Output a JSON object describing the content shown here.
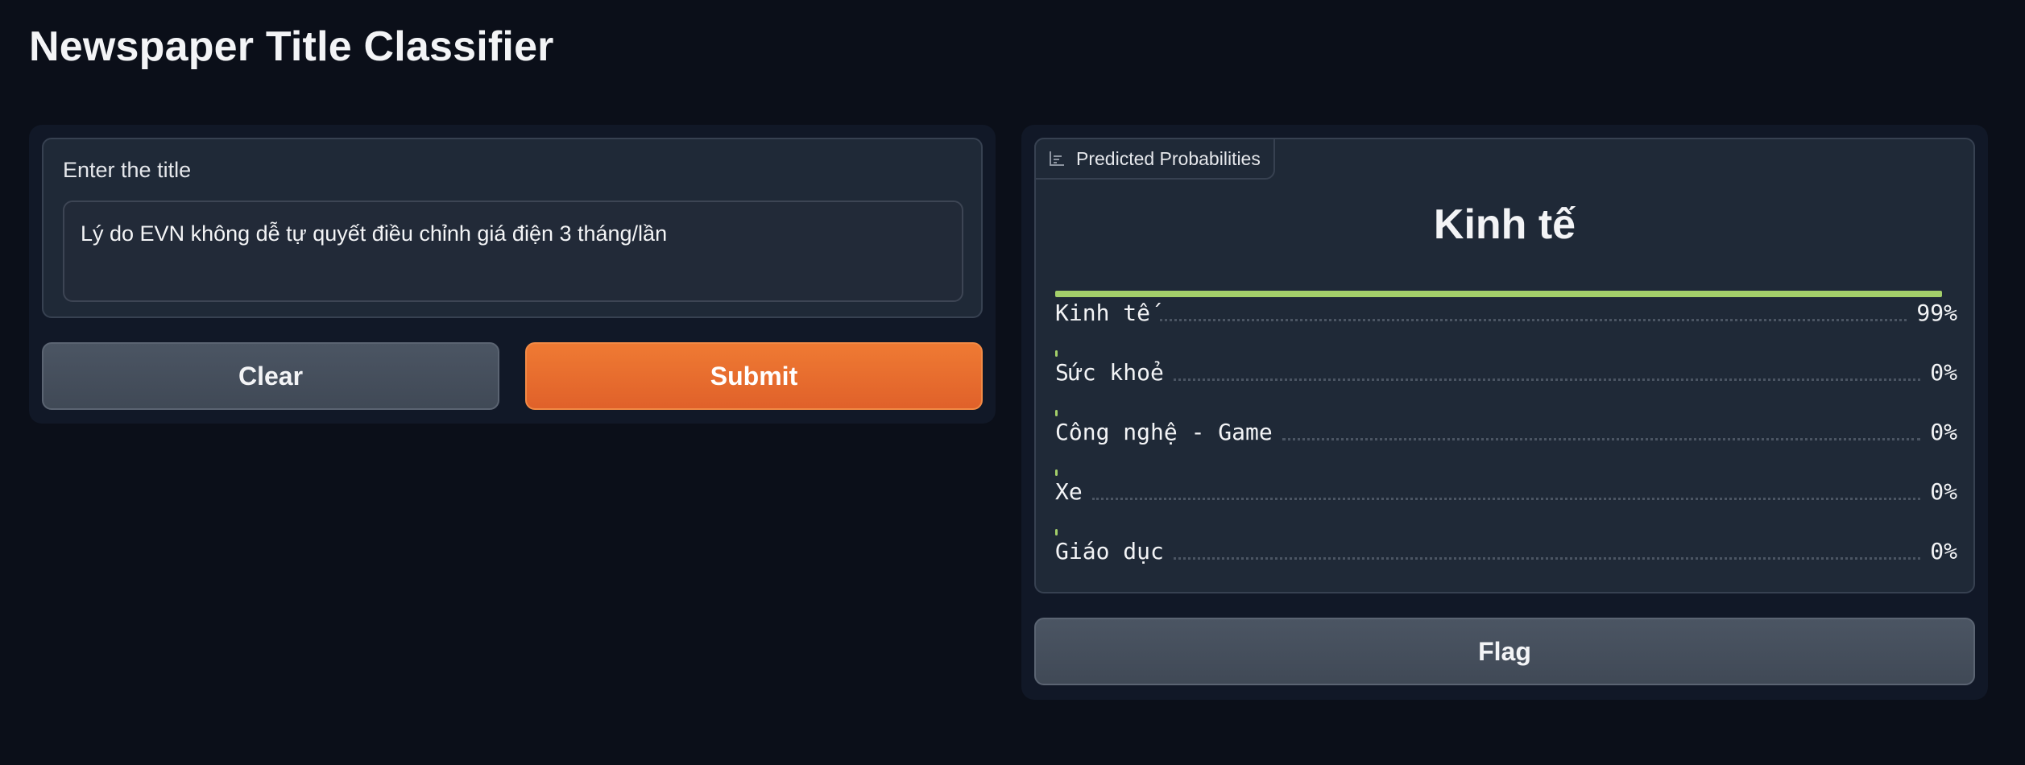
{
  "app": {
    "title": "Newspaper Title Classifier"
  },
  "input": {
    "label": "Enter the title",
    "value": "Lý do EVN không dễ tự quyết điều chỉnh giá điện 3 tháng/lần"
  },
  "buttons": {
    "clear_label": "Clear",
    "submit_label": "Submit",
    "flag_label": "Flag"
  },
  "output": {
    "tab_label": "Predicted Probabilities",
    "tab_icon": "bar-chart-icon",
    "predicted_label": "Kinh tế",
    "confidences": [
      {
        "label": "Kinh tế",
        "value": "99%",
        "fraction": 0.99
      },
      {
        "label": "Sức khoẻ",
        "value": "0%",
        "fraction": 0.0
      },
      {
        "label": "Công nghệ - Game",
        "value": "0%",
        "fraction": 0.0
      },
      {
        "label": "Xe",
        "value": "0%",
        "fraction": 0.0
      },
      {
        "label": "Giáo dục",
        "value": "0%",
        "fraction": 0.0
      }
    ]
  },
  "colors": {
    "background": "#0b0f19",
    "panel": "#111827",
    "block": "#1f2937",
    "primary_button": "#e9702f",
    "secondary_button": "#4b5563",
    "confidence_bar": "#a3cf6a"
  }
}
